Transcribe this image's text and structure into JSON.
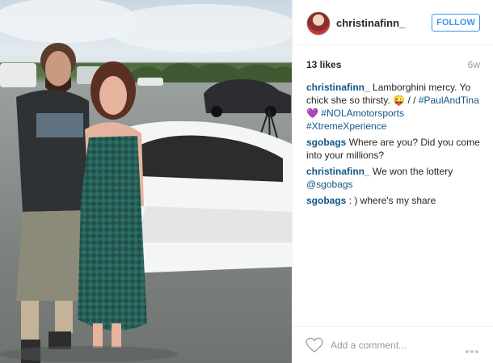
{
  "post": {
    "username": "christinafinn_",
    "follow_label": "FOLLOW",
    "likes": "13 likes",
    "age": "6w",
    "caption": {
      "user": "christinafinn_",
      "text_1": "Lamborghini mercy. Yo chick she so thirsty.",
      "emoji_1": "😜",
      "text_2": "/ /",
      "tag_1": "#PaulAndTina",
      "emoji_2": "💜",
      "tag_2": "#NOLAmotorsports",
      "tag_3": "#XtremeXperience"
    },
    "comments": [
      {
        "user": "sgobags",
        "text": "Where are you? Did you come into your millions?"
      },
      {
        "user": "christinafinn_",
        "text": "We won the lottery",
        "mention": "@sgobags"
      },
      {
        "user": "sgobags",
        "text": ": ) where's my share"
      }
    ],
    "add_comment_placeholder": "Add a comment...",
    "icons": {
      "like": "heart-icon",
      "more": "more-options-icon"
    },
    "colors": {
      "link": "#125688",
      "follow": "#3897f0",
      "muted": "#999999"
    }
  }
}
